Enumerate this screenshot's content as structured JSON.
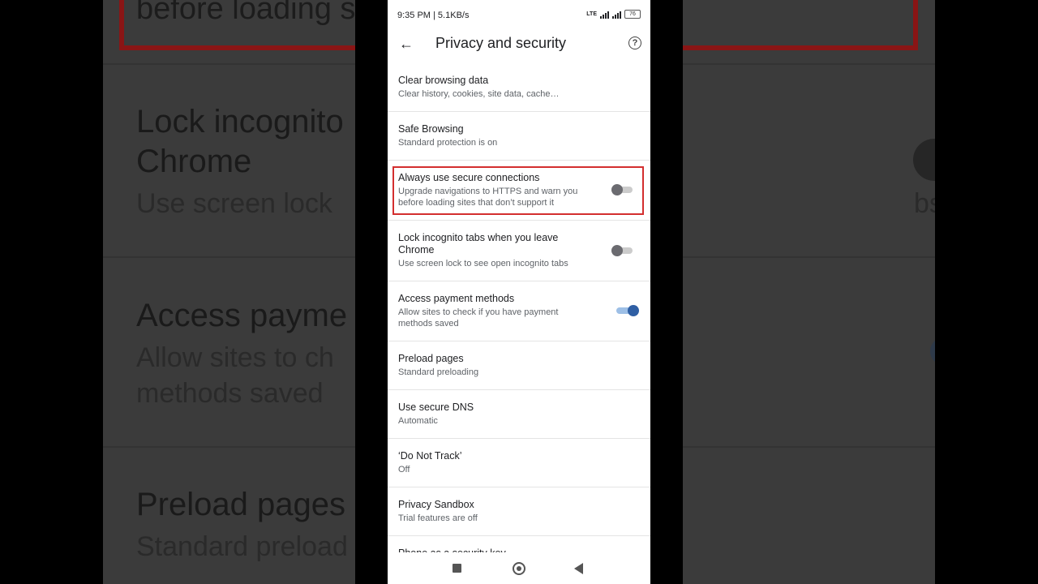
{
  "status_bar": {
    "time": "9:35 PM | 5.1KB/s",
    "network": "LTE",
    "battery": "76"
  },
  "app_bar": {
    "title": "Privacy and security"
  },
  "settings": [
    {
      "title": "Clear browsing data",
      "subtitle": "Clear history, cookies, site data, cache…"
    },
    {
      "title": "Safe Browsing",
      "subtitle": "Standard protection is on"
    },
    {
      "title": "Always use secure connections",
      "subtitle": "Upgrade navigations to HTTPS and warn you before loading sites that don’t support it",
      "toggle": "off"
    },
    {
      "title": "Lock incognito tabs when you leave Chrome",
      "subtitle": "Use screen lock to see open incognito tabs",
      "toggle": "off"
    },
    {
      "title": "Access payment methods",
      "subtitle": "Allow sites to check if you have payment methods saved",
      "toggle": "on"
    },
    {
      "title": "Preload pages",
      "subtitle": "Standard preloading"
    },
    {
      "title": "Use secure DNS",
      "subtitle": "Automatic"
    },
    {
      "title": "‘Do Not Track’",
      "subtitle": "Off"
    },
    {
      "title": "Privacy Sandbox",
      "subtitle": "Trial features are off"
    },
    {
      "title": "Phone as a security key"
    }
  ],
  "background": {
    "partial_text": "before loading s",
    "lock_title_1": "Lock incognito",
    "lock_title_2": "Chrome",
    "lock_sub": "Use screen lock",
    "lock_sub_right": "bs",
    "payment_title": "Access payme",
    "payment_sub_1": "Allow sites to ch",
    "payment_sub_2": "methods saved",
    "preload_title": "Preload pages",
    "preload_sub": "Standard preload"
  },
  "colors": {
    "highlight": "#d32f2f",
    "toggle_on": "#2f5fa4",
    "toggle_off": "#6b6b70"
  }
}
